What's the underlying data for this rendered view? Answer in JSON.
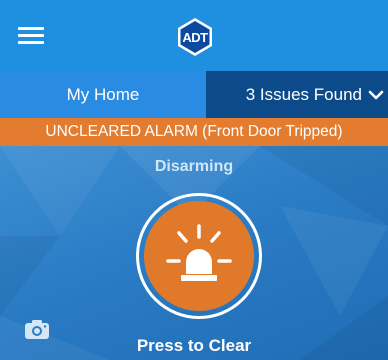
{
  "header": {
    "logo_text": "ADT",
    "menu_icon": "hamburger-icon",
    "colors": {
      "bar": "#1f8fe0",
      "logo_bg": "#0b4aa0"
    }
  },
  "tabs": {
    "home_label": "My Home",
    "issues_label": "3 Issues Found",
    "issues_icon": "chevron-down-icon"
  },
  "banner": {
    "text": "UNCLEARED ALARM (Front Door Tripped)",
    "color": "#e37c2e"
  },
  "main": {
    "status_text": "Disarming",
    "alarm_button_icon": "siren-icon",
    "alarm_button_color": "#e07a2a",
    "press_label": "Press to Clear",
    "camera_icon": "camera-icon"
  }
}
